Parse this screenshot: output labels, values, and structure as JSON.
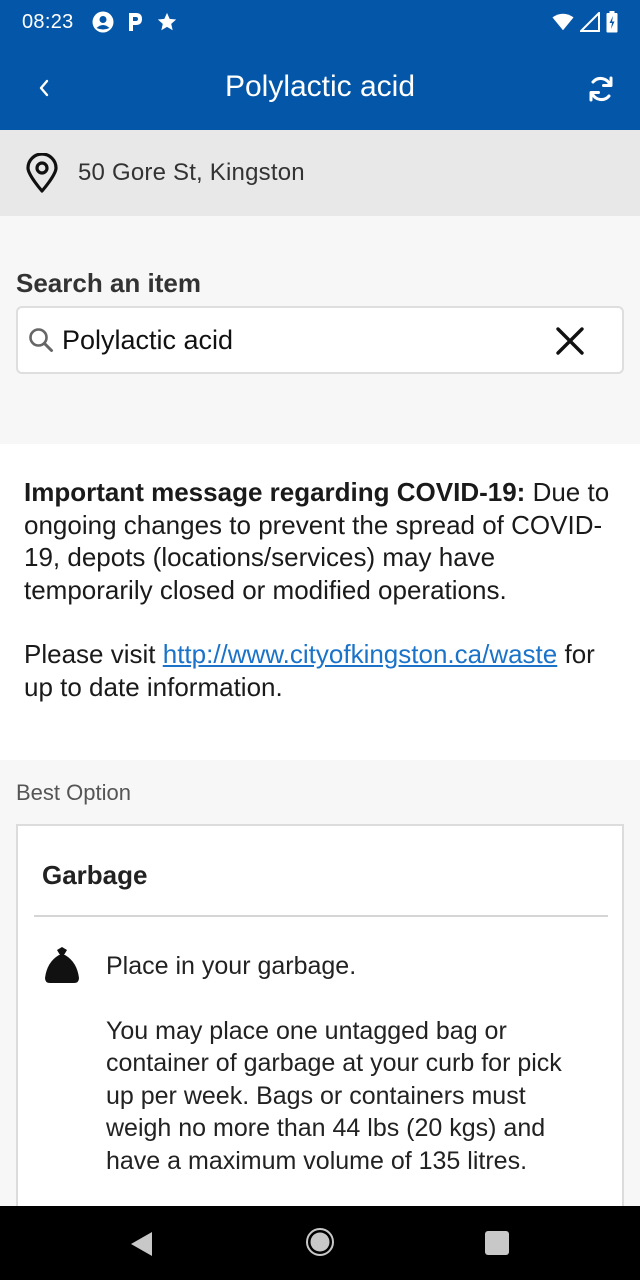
{
  "status_bar": {
    "time": "08:23",
    "icons": [
      "account-circle-icon",
      "parking-icon",
      "star-icon",
      "wifi-icon",
      "signal-icon",
      "battery-charging-icon"
    ]
  },
  "app_bar": {
    "title": "Polylactic acid",
    "back_icon": "chevron-left-icon",
    "refresh_icon": "refresh-icon"
  },
  "location": {
    "icon": "map-pin-icon",
    "address": "50 Gore St, Kingston"
  },
  "search": {
    "label": "Search an item",
    "value": "Polylactic acid",
    "icon": "search-icon",
    "clear_icon": "close-icon"
  },
  "notice": {
    "heading": "Important message regarding COVID-19:",
    "body": " Due to ongoing changes to prevent the spread of COVID-19, depots (locations/services) may have temporarily closed or modified operations.",
    "visit_prefix": "Please visit ",
    "link_text": "http://www.cityofkingston.ca/waste",
    "visit_suffix": " for up to date information."
  },
  "options": {
    "section_label": "Best Option",
    "card": {
      "title": "Garbage",
      "icon": "garbage-bag-icon",
      "instruction": "Place in your garbage.",
      "details": "You may place one untagged bag or container of garbage at your curb for pick up per week. Bags or containers must weigh no more than 44 lbs (20 kgs) and have a maximum volume of 135 litres."
    }
  },
  "nav_bar": {
    "icons": [
      "back-triangle-icon",
      "home-circle-icon",
      "recents-square-icon"
    ]
  },
  "colors": {
    "primary": "#0457a8",
    "link": "#1a73c8",
    "background_light": "#f7f7f7",
    "location_bar": "#e8e8e8"
  }
}
